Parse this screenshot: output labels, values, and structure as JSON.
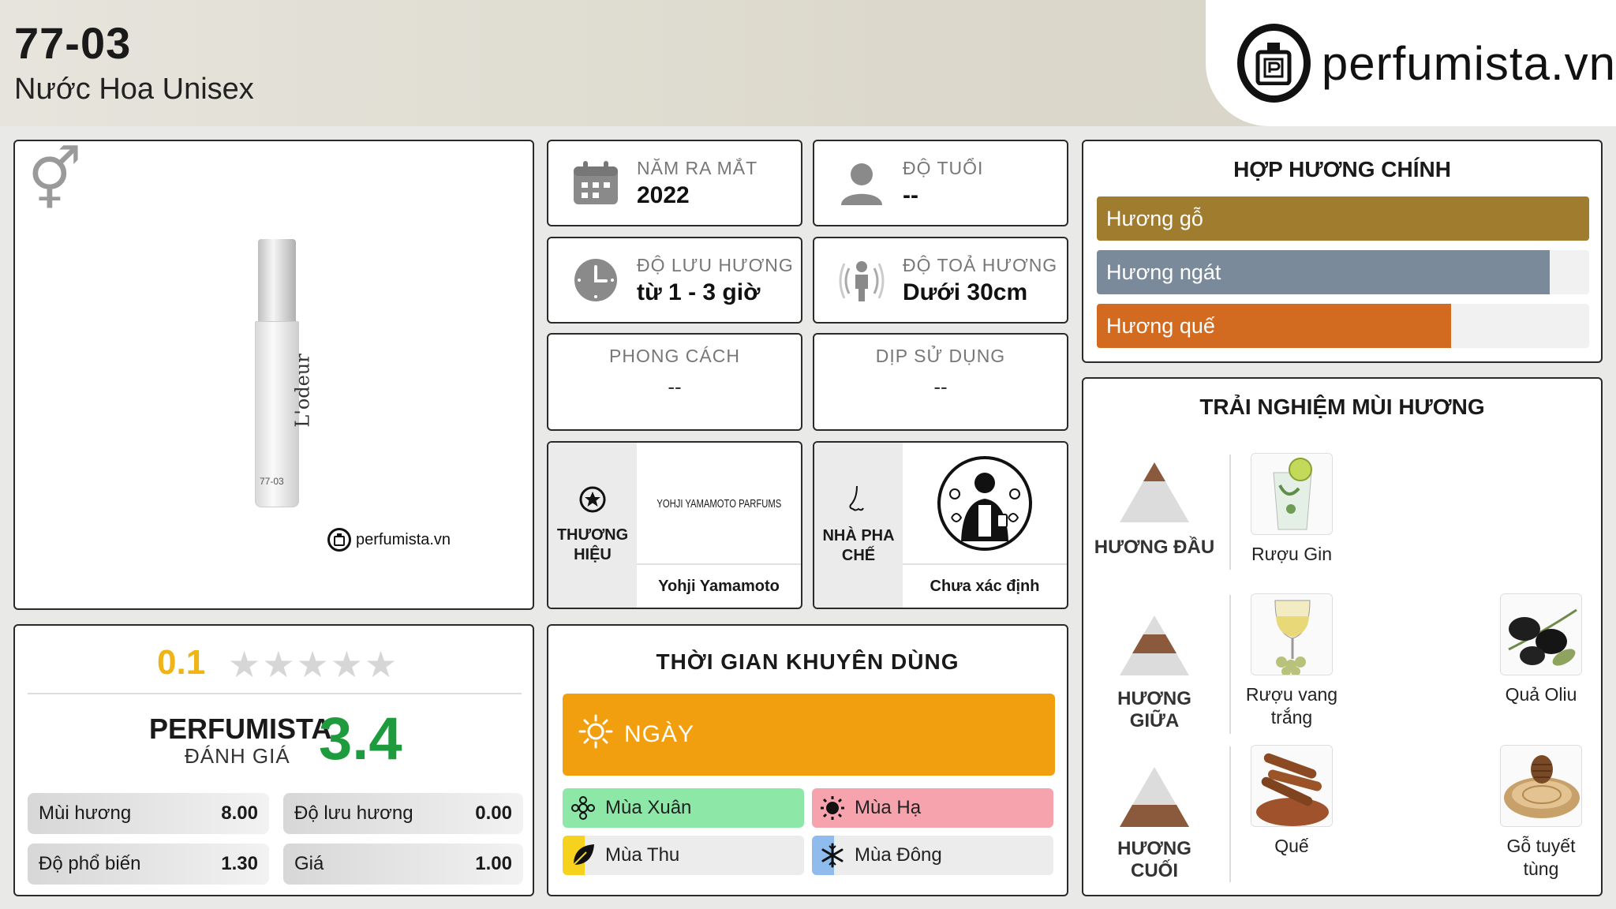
{
  "header": {
    "code": "77-03",
    "subtitle": "Nước Hoa Unisex",
    "logo_text": "perfumista.vn"
  },
  "product": {
    "gender_icon": "unisex-icon",
    "bottle_label": "L'odeur",
    "bottle_number": "77-03",
    "watermark": "perfumista.vn"
  },
  "rating": {
    "user_score": "0.1",
    "stars_total": 5,
    "perfumista_label": "PERFUMISTA",
    "perfumista_sub": "ĐÁNH GIÁ",
    "perfumista_score": "3.4",
    "metrics": [
      {
        "label": "Mùi hương",
        "value": "8.00"
      },
      {
        "label": "Độ lưu hương",
        "value": "0.00"
      },
      {
        "label": "Độ phổ biến",
        "value": "1.30"
      },
      {
        "label": "Giá",
        "value": "1.00"
      }
    ]
  },
  "info": {
    "release": {
      "label": "NĂM RA MẮT",
      "value": "2022",
      "icon": "calendar-icon"
    },
    "age": {
      "label": "ĐỘ TUỔI",
      "value": "--",
      "icon": "person-icon"
    },
    "longevity": {
      "label": "ĐỘ LƯU HƯƠNG",
      "value": "từ 1 - 3 giờ",
      "icon": "clock-icon"
    },
    "sillage": {
      "label": "ĐỘ TOẢ HƯƠNG",
      "value": "Dưới 30cm",
      "icon": "sillage-icon"
    },
    "style": {
      "label": "PHONG CÁCH",
      "value": "--"
    },
    "occasion": {
      "label": "DỊP SỬ DỤNG",
      "value": "--"
    },
    "brand": {
      "side_label": "THƯƠNG HIỆU",
      "logo_text": "YOHJI YAMAMOTO PARFUMS",
      "name": "Yohji Yamamoto",
      "icon": "star-circle-icon"
    },
    "perfumer": {
      "side_label": "NHÀ PHA CHẾ",
      "name": "Chưa xác định",
      "icon": "nose-icon"
    }
  },
  "time": {
    "title": "THỜI GIAN KHUYÊN DÙNG",
    "day_label": "NGÀY",
    "seasons": [
      {
        "label": "Mùa Xuân",
        "icon": "flower-icon",
        "color": "#8de8a8"
      },
      {
        "label": "Mùa Hạ",
        "icon": "sun-icon",
        "color": "#f7a3ae"
      },
      {
        "label": "Mùa Thu",
        "icon": "leaf-icon",
        "color": "#ececec",
        "accent": "#f6d21e"
      },
      {
        "label": "Mùa Đông",
        "icon": "snowflake-icon",
        "color": "#ececec",
        "accent": "#8fbcec"
      }
    ]
  },
  "accords": {
    "title": "HỢP HƯƠNG CHÍNH",
    "items": [
      {
        "label": "Hương gỗ",
        "level": 100,
        "color": "#a07c2f"
      },
      {
        "label": "Hương ngát",
        "level": 92,
        "color": "#7b8a9a"
      },
      {
        "label": "Hương quế",
        "level": 72,
        "color": "#d26a20"
      }
    ]
  },
  "experience": {
    "title": "TRẢI NGHIỆM MÙI HƯƠNG",
    "layers": [
      {
        "name": "HƯƠNG ĐẦU",
        "notes": [
          "Rượu Gin"
        ]
      },
      {
        "name": "HƯƠNG GIỮA",
        "notes": [
          "Rượu vang trắng",
          "Quả Oliu"
        ]
      },
      {
        "name": "HƯƠNG CUỐI",
        "notes": [
          "Quế",
          "Gỗ tuyết tùng"
        ]
      }
    ]
  }
}
